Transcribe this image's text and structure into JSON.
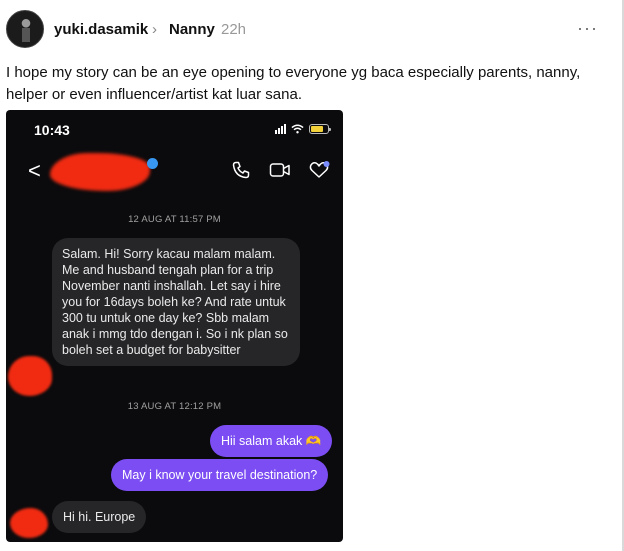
{
  "post": {
    "username": "yuki.dasamik",
    "chevron": "›",
    "topic": "Nanny",
    "age": "22h",
    "more": "···",
    "text": "I hope my story can be an eye opening to everyone yg baca especially parents, nanny, helper or even influencer/artist kat luar sana."
  },
  "screenshot": {
    "status_time": "10:43",
    "back_glyph": "<",
    "icons": [
      "phone-icon",
      "video-icon",
      "heart-icon"
    ],
    "colors": {
      "background": "#0b0b0d",
      "incoming_bubble": "#262629",
      "outgoing_bubble": "#7b4df2",
      "redaction": "#f02b12",
      "battery": "#f3d13a"
    },
    "timestamp1": "12 AUG AT 11:57 PM",
    "message1": "Salam. Hi! Sorry kacau malam malam. Me and husband tengah plan for a trip November nanti inshallah. Let say i hire you for 16days boleh ke? And rate untuk 300 tu untuk one day ke? Sbb malam anak i mmg tdo dengan i. So i nk plan so boleh set a budget for babysitter",
    "timestamp2": "13 AUG AT 12:12 PM",
    "reply1": "Hii salam akak 🫶",
    "reply2": "May i know your travel destination?",
    "message2": "Hi hi. Europe"
  }
}
